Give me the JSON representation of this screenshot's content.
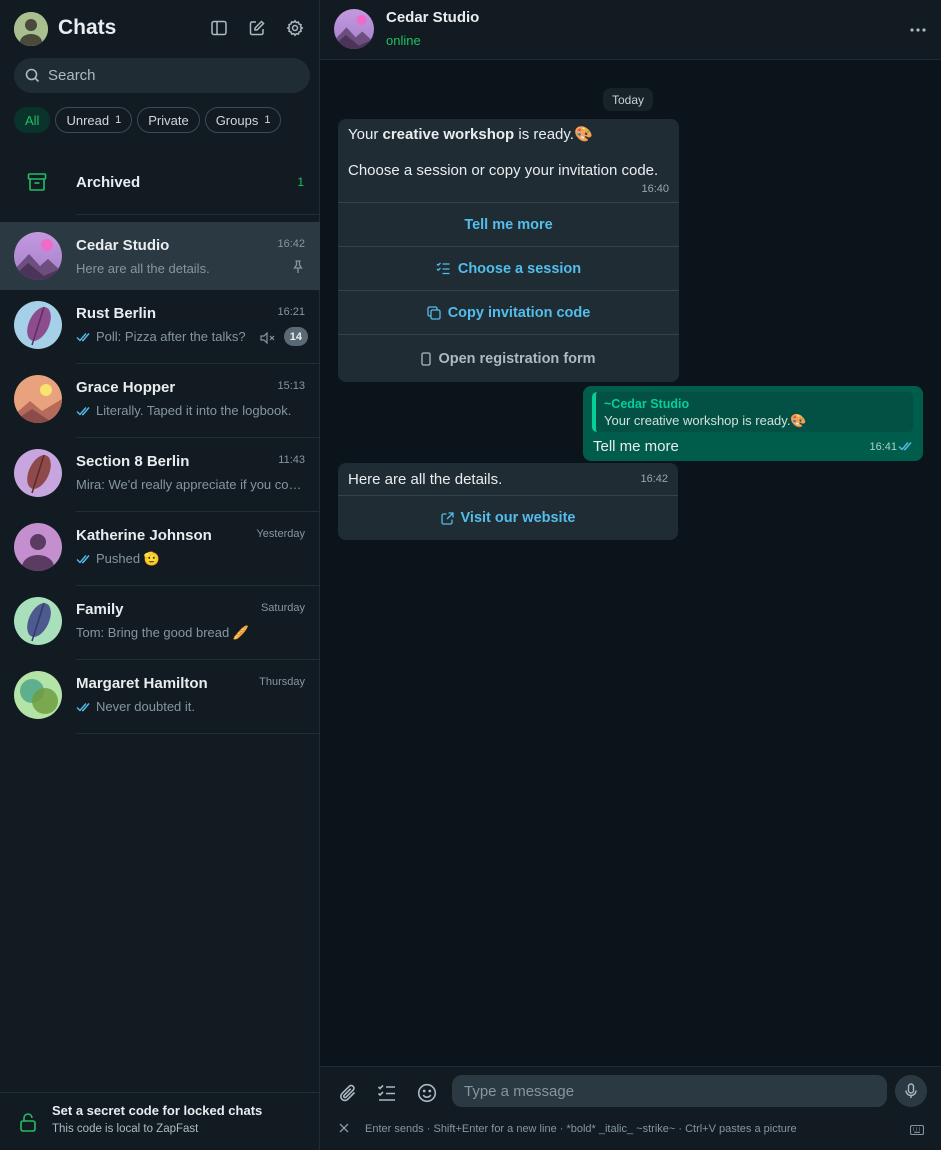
{
  "sidebar": {
    "title": "Chats",
    "search_placeholder": "Search",
    "filters": [
      {
        "label": "All",
        "count": ""
      },
      {
        "label": "Unread",
        "count": "1"
      },
      {
        "label": "Private",
        "count": ""
      },
      {
        "label": "Groups",
        "count": "1"
      }
    ],
    "archived": {
      "label": "Archived",
      "count": "1"
    },
    "chats": [
      {
        "name": "Cedar Studio",
        "time": "16:42",
        "preview": "Here are all the details."
      },
      {
        "name": "Rust Berlin",
        "time": "16:21",
        "preview": "Poll: Pizza after the talks?",
        "unread": "14"
      },
      {
        "name": "Grace Hopper",
        "time": "15:13",
        "preview": "Literally. Taped it into the logbook."
      },
      {
        "name": "Section 8 Berlin",
        "time": "11:43",
        "preview": "Mira: We'd really appreciate if you could help"
      },
      {
        "name": "Katherine Johnson",
        "time": "Yesterday",
        "preview": "Pushed 🫡"
      },
      {
        "name": "Family",
        "time": "Saturday",
        "preview": "Tom: Bring the good bread 🥖"
      },
      {
        "name": "Margaret Hamilton",
        "time": "Thursday",
        "preview": "Never doubted it."
      }
    ],
    "footer": {
      "title": "Set a secret code for locked chats",
      "subtitle": "This code is local to ZapFast"
    }
  },
  "conversation": {
    "name": "Cedar Studio",
    "status": "online",
    "day_label": "Today",
    "message1": {
      "pre": "Your ",
      "bold": "creative workshop",
      "post": " is ready.🎨",
      "line2": "Choose a session or copy your invitation code.",
      "time": "16:40",
      "buttons": [
        "Tell me more",
        "Choose a session",
        "Copy invitation code",
        "Open registration form"
      ]
    },
    "reply": {
      "quote_author": "~Cedar Studio",
      "quote_text": "Your creative workshop is ready.🎨",
      "text": "Tell me more",
      "time": "16:41"
    },
    "message2": {
      "text": "Here are all the details.",
      "time": "16:42",
      "button": "Visit our website"
    }
  },
  "composer": {
    "placeholder": "Type a message",
    "hint": "Enter sends · Shift+Enter for a new line · *bold* _italic_ ~strike~ · Ctrl+V pastes a picture"
  },
  "colors": {
    "accent": "#21c063",
    "link": "#53bdeb",
    "outgoing": "#005c4b"
  }
}
